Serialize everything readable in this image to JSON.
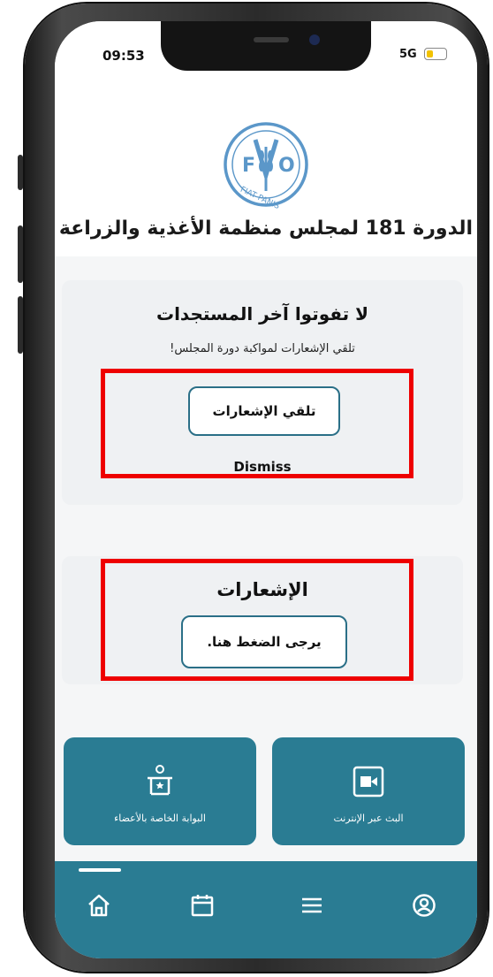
{
  "status_bar": {
    "time": "09:53",
    "network": "5G"
  },
  "header": {
    "logo_text": "FIAT PANIS",
    "title": "الدورة 181 لمجلس منظمة الأغذية والزراعة"
  },
  "notify_card": {
    "heading": "لا تفوتوا آخر المستجدات",
    "subtitle": "تلقي الإشعارات لمواكبة دورة المجلس!",
    "button_label": "تلقي الإشعارات",
    "dismiss_label": "Dismiss"
  },
  "notifications_card": {
    "heading": "الإشعارات",
    "button_label": "يرجى الضغط هنا."
  },
  "tiles": {
    "members_portal": "البوابة الخاصة بالأعضاء",
    "webcast": "البث عبر الإنترنت"
  },
  "colors": {
    "accent": "#2a7c93",
    "highlight": "#ee0000",
    "button_border": "#2a6f87"
  },
  "icons": {
    "nav": [
      "home-icon",
      "calendar-icon",
      "menu-icon",
      "profile-icon"
    ],
    "tiles": [
      "podium-icon",
      "video-icon"
    ]
  }
}
